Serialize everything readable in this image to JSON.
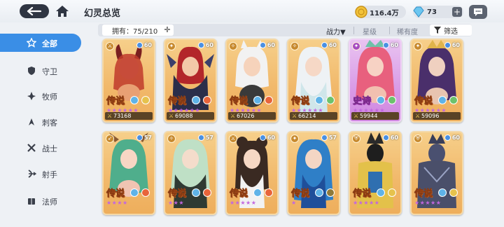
{
  "header": {
    "title": "幻灵总览",
    "gold": "116.4万",
    "gems": "73",
    "plus": "+"
  },
  "sidebar": {
    "items": [
      {
        "label": "全部",
        "icon": "star-icon",
        "active": true
      },
      {
        "label": "守卫",
        "icon": "shield-icon",
        "active": false
      },
      {
        "label": "牧师",
        "icon": "priest-icon",
        "active": false
      },
      {
        "label": "刺客",
        "icon": "assassin-icon",
        "active": false
      },
      {
        "label": "战士",
        "icon": "warrior-icon",
        "active": false
      },
      {
        "label": "射手",
        "icon": "archer-icon",
        "active": false
      },
      {
        "label": "法师",
        "icon": "mage-icon",
        "active": false
      }
    ]
  },
  "filter": {
    "owned": "拥有：75/210",
    "sort_power": "战力▼",
    "sort_star": "星级",
    "sort_rarity": "稀有度",
    "filter_label": "筛选"
  },
  "cards": [
    {
      "rank": "传说",
      "level": "60",
      "stars": "★★★★★★",
      "power": "73168",
      "rarity": "legend"
    },
    {
      "rank": "传说",
      "level": "60",
      "stars": "★★★★★★",
      "power": "69088",
      "rarity": "legend"
    },
    {
      "rank": "传说",
      "level": "60",
      "stars": "★★★★★★",
      "power": "67026",
      "rarity": "legend"
    },
    {
      "rank": "传说",
      "level": "60",
      "stars": "★★★★★★",
      "power": "66214",
      "rarity": "legend"
    },
    {
      "rank": "史诗",
      "level": "60",
      "stars": "★★★★★★",
      "power": "59944",
      "rarity": "epic"
    },
    {
      "rank": "传说",
      "level": "60",
      "stars": "★★★★★★",
      "power": "59096",
      "rarity": "legend"
    },
    {
      "rank": "传说",
      "level": "57",
      "stars": "★★★★",
      "power": "",
      "rarity": "legend"
    },
    {
      "rank": "传说",
      "level": "57",
      "stars": "★★★",
      "power": "",
      "rarity": "legend"
    },
    {
      "rank": "传说",
      "level": "60",
      "stars": "★★★★★",
      "power": "",
      "rarity": "legend"
    },
    {
      "rank": "传说",
      "level": "57",
      "stars": "★",
      "power": "",
      "rarity": "legend"
    },
    {
      "rank": "传说",
      "level": "60",
      "stars": "★★★★★",
      "power": "",
      "rarity": "legend"
    },
    {
      "rank": "传说",
      "level": "60",
      "stars": "★★★★★",
      "power": "",
      "rarity": "legend"
    }
  ],
  "colors": {
    "accent": "#3a8ee6",
    "legend_card": "#f1b86a",
    "epic_card": "#d99be6"
  }
}
